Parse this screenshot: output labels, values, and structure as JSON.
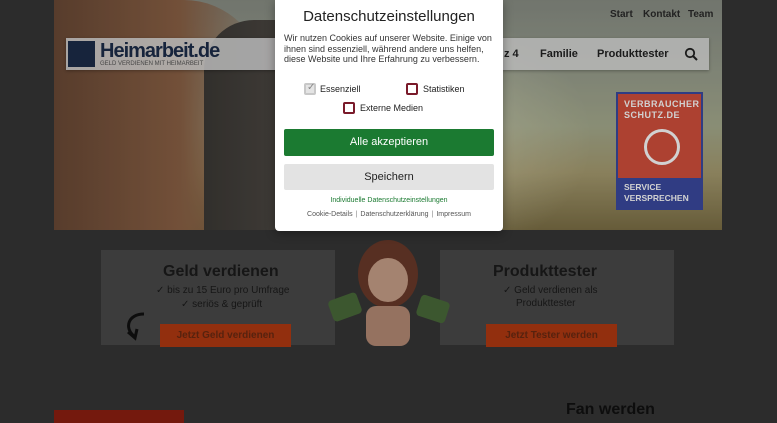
{
  "site": {
    "topnav": [
      "Start",
      "Kontakt",
      "Team"
    ],
    "logo_text": "Heimarbeit.de",
    "logo_sub": "GELD VERDIENEN MIT HEIMARBEIT",
    "nav": [
      "z 4",
      "Familie",
      "Produkttester"
    ],
    "badge": {
      "line1": "VERBRAUCHER",
      "line2": "SCHUTZ.DE",
      "line3": "SERVICE",
      "line4": "VERSPRECHEN"
    },
    "left_panel": {
      "title": "Geld verdienen",
      "line1": "bis zu 15 Euro pro Umfrage",
      "line2": "seriös & geprüft",
      "button": "Jetzt Geld verdienen"
    },
    "right_panel": {
      "title": "Produkttester",
      "line1": "Geld verdienen als",
      "line2": "Produkttester",
      "button": "Jetzt Tester werden"
    },
    "fan": "Fan werden"
  },
  "consent": {
    "title": "Datenschutzeinstellungen",
    "description": "Wir nutzen Cookies auf unserer Website. Einige von ihnen sind essenziell, während andere uns helfen, diese Website und Ihre Erfahrung zu verbessern.",
    "options": [
      {
        "label": "Essenziell",
        "checked": true
      },
      {
        "label": "Statistiken",
        "checked": false
      },
      {
        "label": "Externe Medien",
        "checked": false
      }
    ],
    "accept_all": "Alle akzeptieren",
    "save": "Speichern",
    "individual": "Individuelle Datenschutzeinstellungen",
    "footer_links": [
      "Cookie-Details",
      "Datenschutzerklärung",
      "Impressum"
    ]
  },
  "colors": {
    "accept": "#1b7a31",
    "checkbox_border": "#7a1a2a",
    "cta": "#b23a12"
  }
}
